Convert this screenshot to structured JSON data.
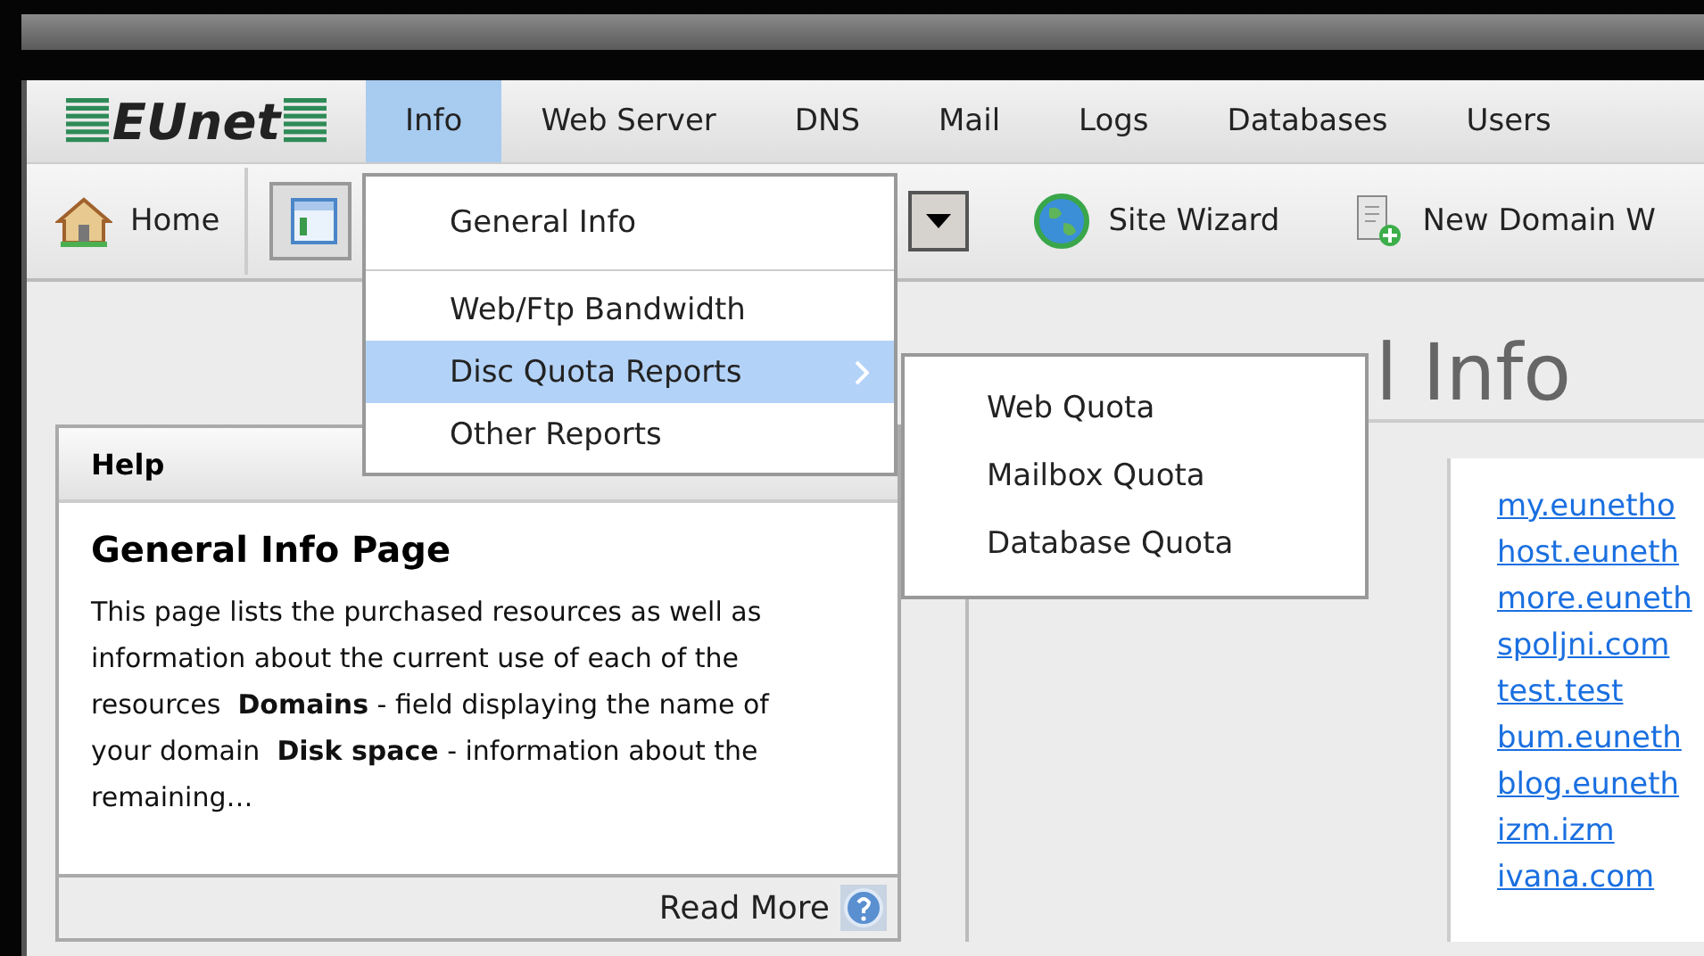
{
  "menubar": {
    "logo": "EUnet",
    "items": [
      {
        "label": "Info",
        "selected": true
      },
      {
        "label": "Web Server",
        "selected": false
      },
      {
        "label": "DNS",
        "selected": false
      },
      {
        "label": "Mail",
        "selected": false
      },
      {
        "label": "Logs",
        "selected": false
      },
      {
        "label": "Databases",
        "selected": false
      },
      {
        "label": "Users",
        "selected": false
      }
    ]
  },
  "toolbar": {
    "items": [
      {
        "kind": "button",
        "label": "Home"
      },
      {
        "kind": "toggle",
        "selected": true
      },
      {
        "kind": "dropdown"
      },
      {
        "kind": "button",
        "label": "Site Wizard"
      },
      {
        "kind": "button",
        "label": "New Domain W"
      }
    ]
  },
  "menu": {
    "items": [
      {
        "kind": "item",
        "label": "General Info",
        "selected": false
      },
      {
        "kind": "separator"
      },
      {
        "kind": "item",
        "label": "Web/Ftp Bandwidth",
        "selected": false
      },
      {
        "kind": "item",
        "label": "Disc Quota Reports",
        "selected": true,
        "children": [
          {
            "label": "Web Quota",
            "selected": false
          },
          {
            "label": "Mailbox Quota",
            "selected": false
          },
          {
            "label": "Database Quota",
            "selected": false
          }
        ]
      },
      {
        "kind": "item",
        "label": "Other Reports",
        "selected": false
      }
    ]
  },
  "help": {
    "title": "Help",
    "heading": "General Info Page",
    "text": "This page lists the purchased resources as well as information about the current use of each of the resources  **Domains** - field displaying the name of your domain  **Disk space** - information about the remaining…",
    "link": "Read More"
  },
  "main": {
    "heading": "l Info",
    "links": [
      "my.eunetho",
      "host.euneth",
      "more.euneth",
      "spoljni.com",
      "test.test",
      "bum.euneth",
      "blog.euneth",
      "izm.izm",
      "ivana.com"
    ]
  }
}
